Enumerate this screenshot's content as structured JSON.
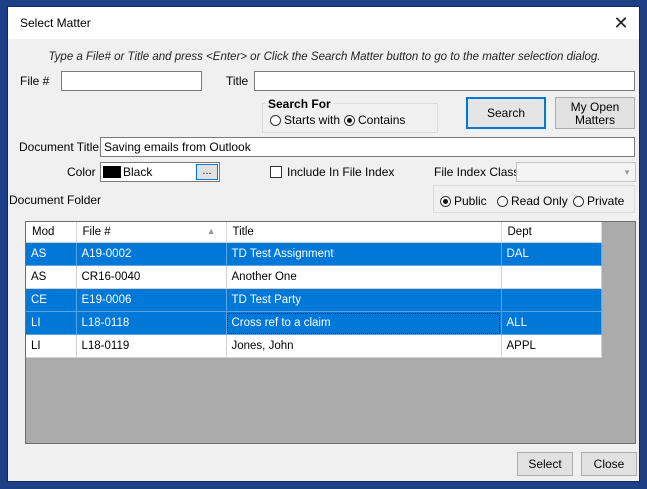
{
  "window": {
    "title": "Select Matter"
  },
  "hint": "Type a File# or Title and press <Enter> or Click the Search Matter button to go to the matter selection dialog.",
  "file_no": {
    "label": "File #",
    "value": ""
  },
  "title_field": {
    "label": "Title",
    "value": ""
  },
  "search_for": {
    "label": "Search For",
    "options": [
      "Starts with",
      "Contains"
    ],
    "selected": "Contains"
  },
  "buttons": {
    "search": "Search",
    "my_open_matters_line1": "My Open",
    "my_open_matters_line2": "Matters",
    "select": "Select",
    "close": "Close"
  },
  "document_title": {
    "label": "Document Title",
    "value": "Saving emails from Outlook"
  },
  "color": {
    "label": "Color",
    "value": "Black",
    "swatch": "#000000",
    "browse": "..."
  },
  "include_in_file_index": {
    "label": "Include In File Index",
    "checked": false
  },
  "file_index_class": {
    "label": "File Index Class",
    "value": ""
  },
  "document_folder": {
    "label": "Document Folder"
  },
  "visibility": {
    "options": [
      "Public",
      "Read Only",
      "Private"
    ],
    "selected": "Public"
  },
  "table": {
    "columns": [
      "Mod",
      "File #",
      "Title",
      "Dept"
    ],
    "sort_column": "File #",
    "rows": [
      {
        "mod": "AS",
        "file": "A19-0002",
        "title": "TD Test Assignment",
        "dept": "DAL",
        "selected": true
      },
      {
        "mod": "AS",
        "file": "CR16-0040",
        "title": "Another One",
        "dept": "",
        "selected": false
      },
      {
        "mod": "CE",
        "file": "E19-0006",
        "title": "TD Test Party",
        "dept": "",
        "selected": true
      },
      {
        "mod": "LI",
        "file": "L18-0118",
        "title": "Cross ref to a claim",
        "dept": "ALL",
        "selected": true
      },
      {
        "mod": "LI",
        "file": "L18-0119",
        "title": "Jones, John",
        "dept": "APPL",
        "selected": false
      }
    ]
  },
  "colors": {
    "selection": "#0078d7",
    "frame": "#1d3f86",
    "accent": "#0078d7"
  }
}
